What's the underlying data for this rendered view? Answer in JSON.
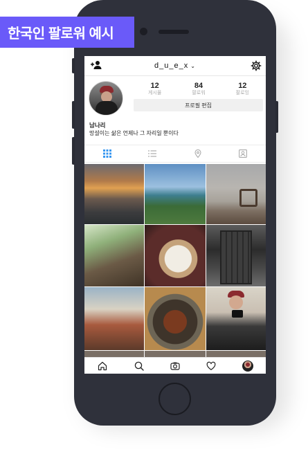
{
  "badge": {
    "text": "한국인 팔로워 예시"
  },
  "profile": {
    "username": "d_u_e_x",
    "stats": [
      {
        "value": "12",
        "label": "게시물"
      },
      {
        "value": "84",
        "label": "팔로워"
      },
      {
        "value": "12",
        "label": "팔로잉"
      }
    ],
    "edit_label": "프로필 편집",
    "display_name": "남나리",
    "bio": "망설이는 삶은 언제나 그 자리일 뿐이다"
  },
  "icons": {
    "add_user": "add-user-icon",
    "username_dropdown": "chevron-down-icon",
    "settings": "gear-icon",
    "tabs": [
      "grid-icon",
      "list-icon",
      "location-pin-icon",
      "tagged-person-icon"
    ],
    "nav": [
      "home-icon",
      "search-icon",
      "camera-icon",
      "heart-icon",
      "profile-avatar"
    ]
  },
  "colors": {
    "badge": "#6a5af9",
    "active_tab": "#3897f0",
    "phone_body": "#2f313b"
  }
}
